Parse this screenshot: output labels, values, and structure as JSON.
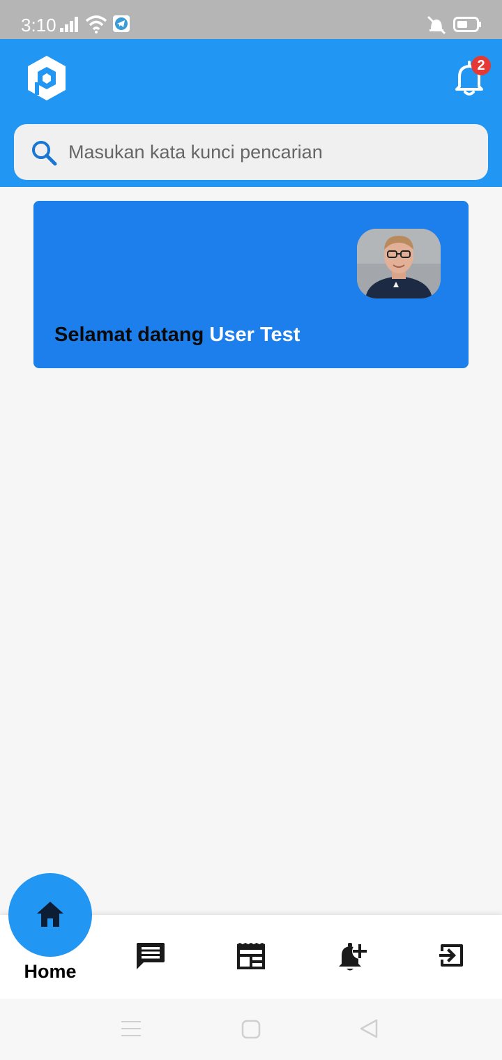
{
  "status_bar": {
    "time": "3:10",
    "icons": [
      "signal-icon",
      "wifi-icon",
      "telegram-icon",
      "vibrate-off-icon",
      "battery-icon"
    ]
  },
  "header": {
    "logo_icon": "app-logo-icon",
    "notification_icon": "bell-icon",
    "notification_count": "2"
  },
  "search": {
    "placeholder": "Masukan kata kunci pencarian",
    "icon": "search-icon"
  },
  "welcome": {
    "greeting": "Selamat datang",
    "user_name": "User Test"
  },
  "bottom_nav": {
    "items": [
      {
        "label": "Home",
        "icon": "home-icon",
        "active": true
      },
      {
        "icon": "chat-icon"
      },
      {
        "icon": "news-icon"
      },
      {
        "icon": "add-alert-icon"
      },
      {
        "icon": "exit-icon"
      }
    ]
  },
  "system_nav": {
    "icons": [
      "menu-icon",
      "square-home-icon",
      "triangle-back-icon"
    ]
  },
  "colors": {
    "status_bar": "#b5b5b5",
    "primary": "#2196f3",
    "card": "#1c7fec",
    "badge": "#e53935",
    "background": "#f6f6f6"
  }
}
